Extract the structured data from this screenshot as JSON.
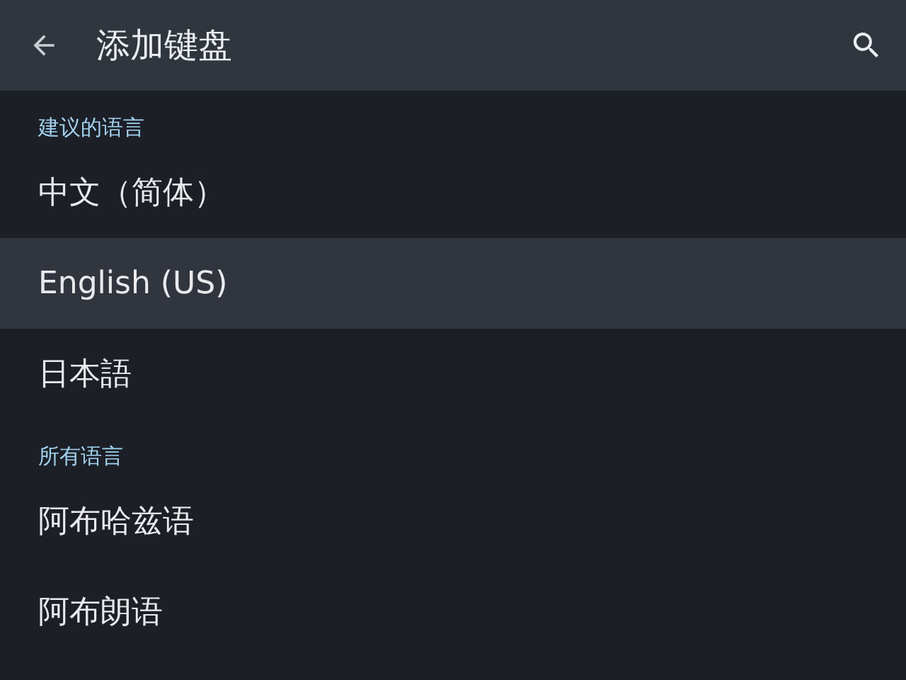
{
  "app_bar": {
    "title": "添加键盘"
  },
  "sections": [
    {
      "header": "建议的语言",
      "items": [
        {
          "label": "中文（简体）",
          "selected": false
        },
        {
          "label": "English (US)",
          "selected": true
        },
        {
          "label": "日本語",
          "selected": false
        }
      ]
    },
    {
      "header": "所有语言",
      "items": [
        {
          "label": "阿布哈兹语",
          "selected": false
        },
        {
          "label": "阿布朗语",
          "selected": false
        }
      ]
    }
  ]
}
